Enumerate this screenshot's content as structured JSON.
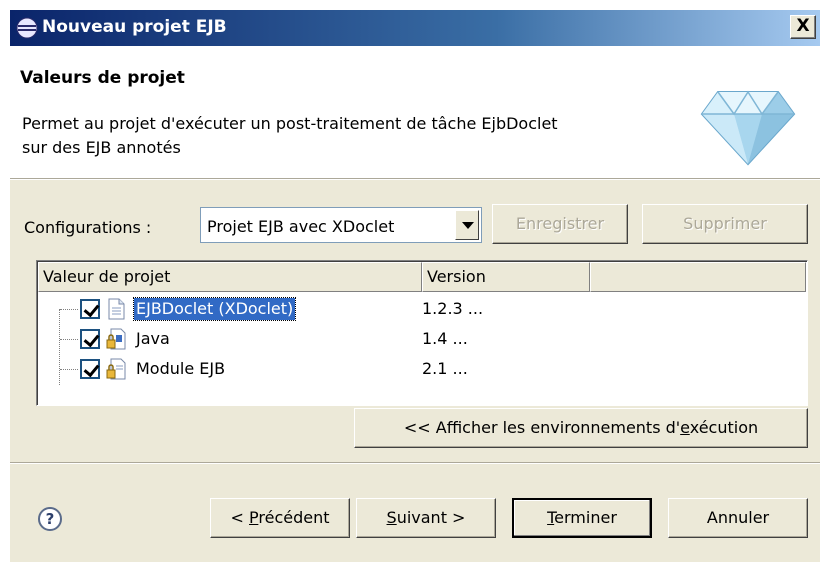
{
  "window": {
    "title": "Nouveau projet EJB",
    "close_label": "X"
  },
  "banner": {
    "title": "Valeurs de projet",
    "description_line1": "Permet au projet d'exécuter un post-traitement de tâche EjbDoclet",
    "description_line2": "sur des EJB annotés",
    "icon": "diamond-icon"
  },
  "configurations": {
    "label": "Configurations :",
    "selected": "Projet EJB avec XDoclet",
    "save_label": "Enregistrer",
    "delete_label": "Supprimer"
  },
  "table": {
    "columns": [
      "Valeur de projet",
      "Version",
      ""
    ],
    "rows": [
      {
        "name": "EJBDoclet (XDoclet)",
        "version": "1.2.3 ...",
        "checked": true,
        "selected": true,
        "icon": "document-icon"
      },
      {
        "name": "Java",
        "version": "1.4 ...",
        "checked": true,
        "selected": false,
        "icon": "java-lock-icon"
      },
      {
        "name": "Module EJB",
        "version": "2.1 ...",
        "checked": true,
        "selected": false,
        "icon": "module-lock-icon"
      }
    ]
  },
  "runtime_button": {
    "label_prefix": "<< Afficher les environnements d'",
    "label_underlined": "e",
    "label_suffix": "xécution"
  },
  "footer": {
    "help_icon": "help-icon",
    "back": {
      "prefix": "< ",
      "underlined": "P",
      "suffix": "récédent"
    },
    "next": {
      "underlined": "S",
      "suffix": "uivant >"
    },
    "finish": {
      "underlined": "T",
      "suffix": "erminer"
    },
    "cancel": "Annuler"
  },
  "colors": {
    "selection": "#316ac5",
    "titlebar": "#0a246a",
    "dialog": "#ece9d8"
  }
}
